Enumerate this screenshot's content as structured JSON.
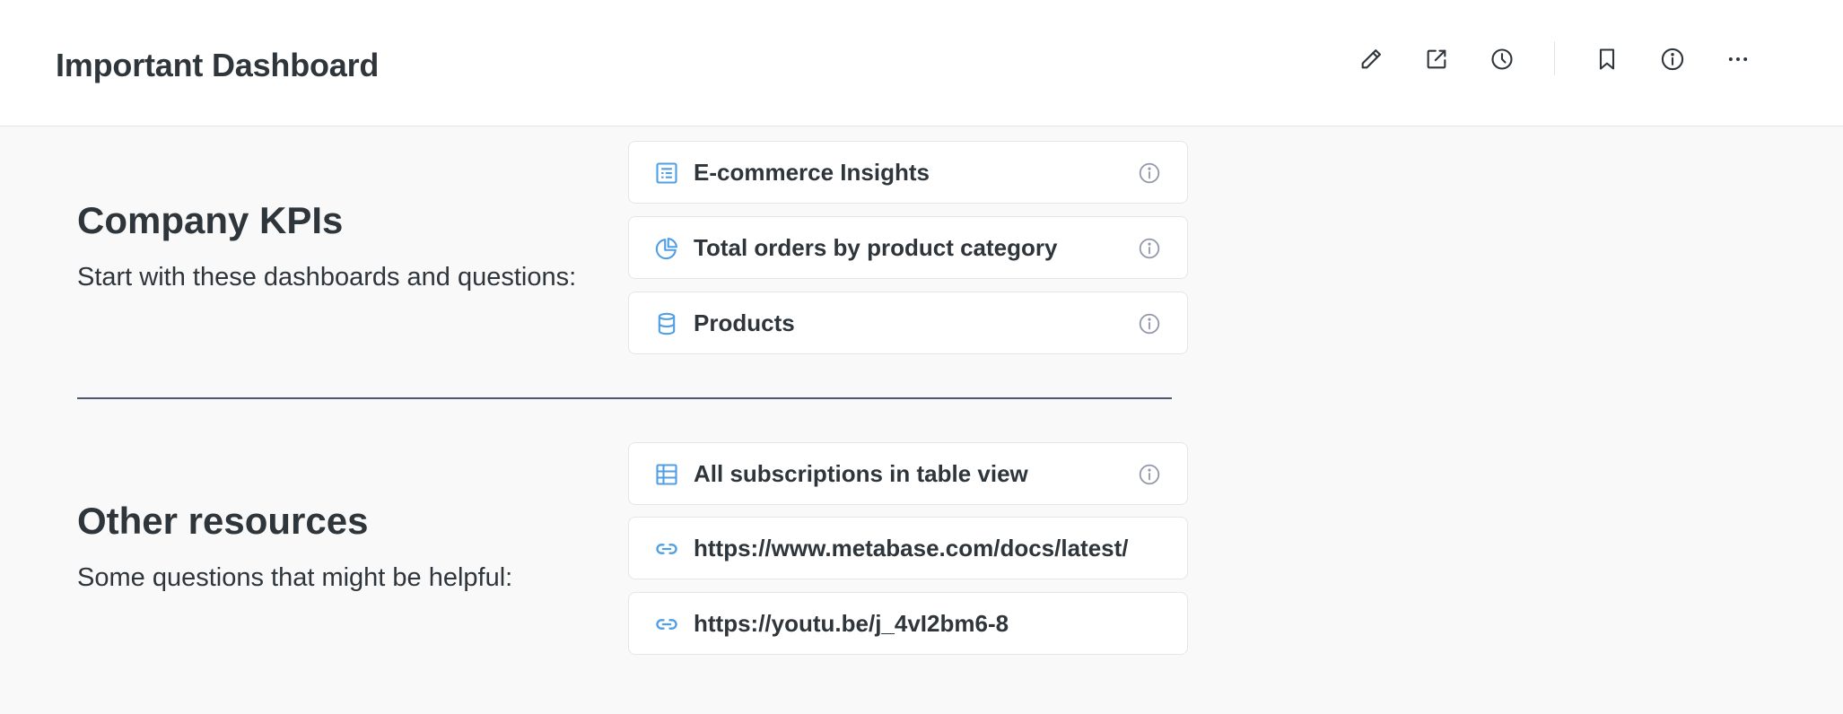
{
  "header": {
    "title": "Important Dashboard",
    "actions": [
      "pencil-icon",
      "share-icon",
      "clock-icon",
      "bookmark-icon",
      "info-icon",
      "more-icon"
    ]
  },
  "sections": [
    {
      "heading": "Company KPIs",
      "subtitle": "Start with these dashboards and questions:",
      "items": [
        {
          "label": "E-commerce Insights",
          "icon": "dashboard-icon",
          "has_info": true
        },
        {
          "label": "Total orders by product category",
          "icon": "pie-chart-icon",
          "has_info": true
        },
        {
          "label": "Products",
          "icon": "database-icon",
          "has_info": true
        }
      ]
    },
    {
      "heading": "Other resources",
      "subtitle": "Some questions that might be helpful:",
      "items": [
        {
          "label": "All subscriptions in table view",
          "icon": "table-icon",
          "has_info": true
        },
        {
          "label": "https://www.metabase.com/docs/latest/",
          "icon": "link-icon",
          "has_info": false
        },
        {
          "label": "https://youtu.be/j_4vI2bm6-8",
          "icon": "link-icon",
          "has_info": false
        }
      ]
    }
  ],
  "colors": {
    "accent": "#509ee3",
    "text": "#2e353b",
    "muted": "#949aab",
    "background": "#f9f9f9",
    "border": "#e4e6e8"
  }
}
